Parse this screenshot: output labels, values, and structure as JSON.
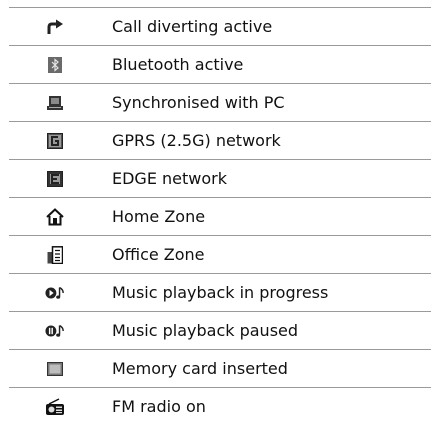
{
  "rows": [
    {
      "icon": "call-divert-icon",
      "label": "Call diverting active"
    },
    {
      "icon": "bluetooth-icon",
      "label": "Bluetooth active"
    },
    {
      "icon": "pc-sync-icon",
      "label": "Synchronised with PC"
    },
    {
      "icon": "gprs-icon",
      "label": "GPRS (2.5G) network"
    },
    {
      "icon": "edge-icon",
      "label": "EDGE network"
    },
    {
      "icon": "home-zone-icon",
      "label": "Home Zone"
    },
    {
      "icon": "office-zone-icon",
      "label": "Office Zone"
    },
    {
      "icon": "music-playing-icon",
      "label": "Music playback in progress"
    },
    {
      "icon": "music-paused-icon",
      "label": "Music playback paused"
    },
    {
      "icon": "memory-card-icon",
      "label": "Memory card inserted"
    },
    {
      "icon": "fm-radio-icon",
      "label": "FM radio on"
    }
  ]
}
